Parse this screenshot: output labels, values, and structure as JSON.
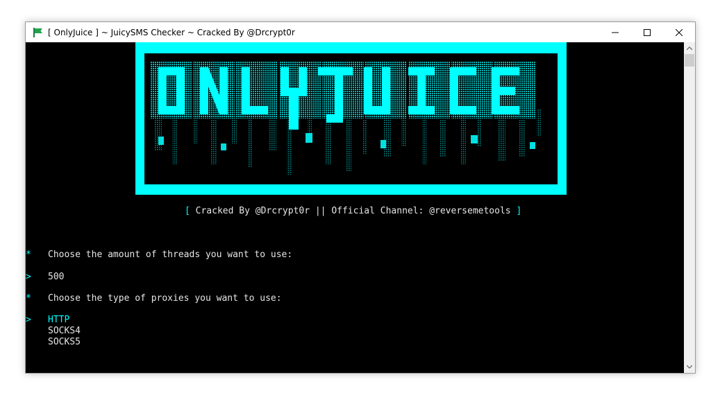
{
  "window": {
    "title": "[ OnlyJuice ] ~ JuicySMS Checker ~ Cracked By @Drcrypt0r",
    "icon": "flag-app-icon",
    "controls": [
      "minimize-icon",
      "maximize-icon",
      "close-icon"
    ]
  },
  "logo": {
    "text": "ONLYJUICE",
    "color": "#00ffff"
  },
  "credits": {
    "open": "[",
    "text": "Cracked By @Drcrypt0r || Official Channel: @reversemetools",
    "close": "]"
  },
  "prompts": [
    {
      "marker": "*",
      "text": "Choose the amount of threads you want to use:"
    },
    {
      "marker": ">",
      "text": "500"
    },
    {
      "marker": "*",
      "text": "Choose the type of proxies you want to use:"
    }
  ],
  "proxy_options": {
    "marker": ">",
    "selected": "HTTP",
    "others": [
      "SOCKS4",
      "SOCKS5"
    ]
  },
  "colors": {
    "console_bg": "#000000",
    "accent": "#00ffff",
    "text": "#e6e6e6"
  }
}
